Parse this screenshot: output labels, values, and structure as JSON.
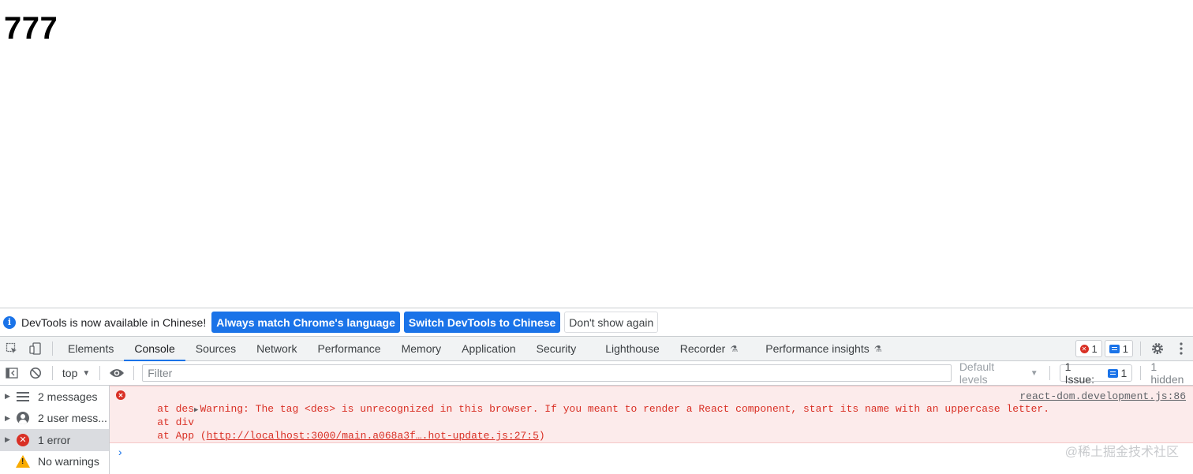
{
  "page": {
    "heading": "777"
  },
  "infobar": {
    "text": "DevTools is now available in Chinese!",
    "btn_match": "Always match Chrome's language",
    "btn_switch": "Switch DevTools to Chinese",
    "btn_dismiss": "Don't show again",
    "icon": "info-icon"
  },
  "tabs": [
    {
      "label": "Elements"
    },
    {
      "label": "Console"
    },
    {
      "label": "Sources"
    },
    {
      "label": "Network"
    },
    {
      "label": "Performance"
    },
    {
      "label": "Memory"
    },
    {
      "label": "Application"
    },
    {
      "label": "Security"
    },
    {
      "label": "Lighthouse"
    },
    {
      "label": "Recorder"
    },
    {
      "label": "Performance insights"
    }
  ],
  "counters": {
    "errors": "1",
    "messages": "1"
  },
  "console_toolbar": {
    "context": "top",
    "filter_placeholder": "Filter",
    "levels": "Default levels",
    "issues_label": "1 Issue:",
    "issues_count": "1",
    "hidden": "1 hidden"
  },
  "sidebar": [
    {
      "label": "2 messages"
    },
    {
      "label": "2 user mess..."
    },
    {
      "label": "1 error"
    },
    {
      "label": "No warnings"
    }
  ],
  "error_message": {
    "line1": "Warning: The tag <des> is unrecognized in this browser. If you meant to render a React component, start its name with an uppercase letter.",
    "line2": "    at des",
    "line3": "    at div",
    "line4_prefix": "    at App (",
    "line4_link": "http://localhost:3000/main.a068a3f….hot-update.js:27:5",
    "line4_suffix": ")",
    "source": "react-dom.development.js:86"
  },
  "prompt_symbol": "›",
  "watermark": "@稀土掘金技术社区",
  "colors": {
    "accent": "#1a73e8",
    "error": "#d93025",
    "error_bg": "#fcebeb",
    "warning": "#f9ab00"
  }
}
